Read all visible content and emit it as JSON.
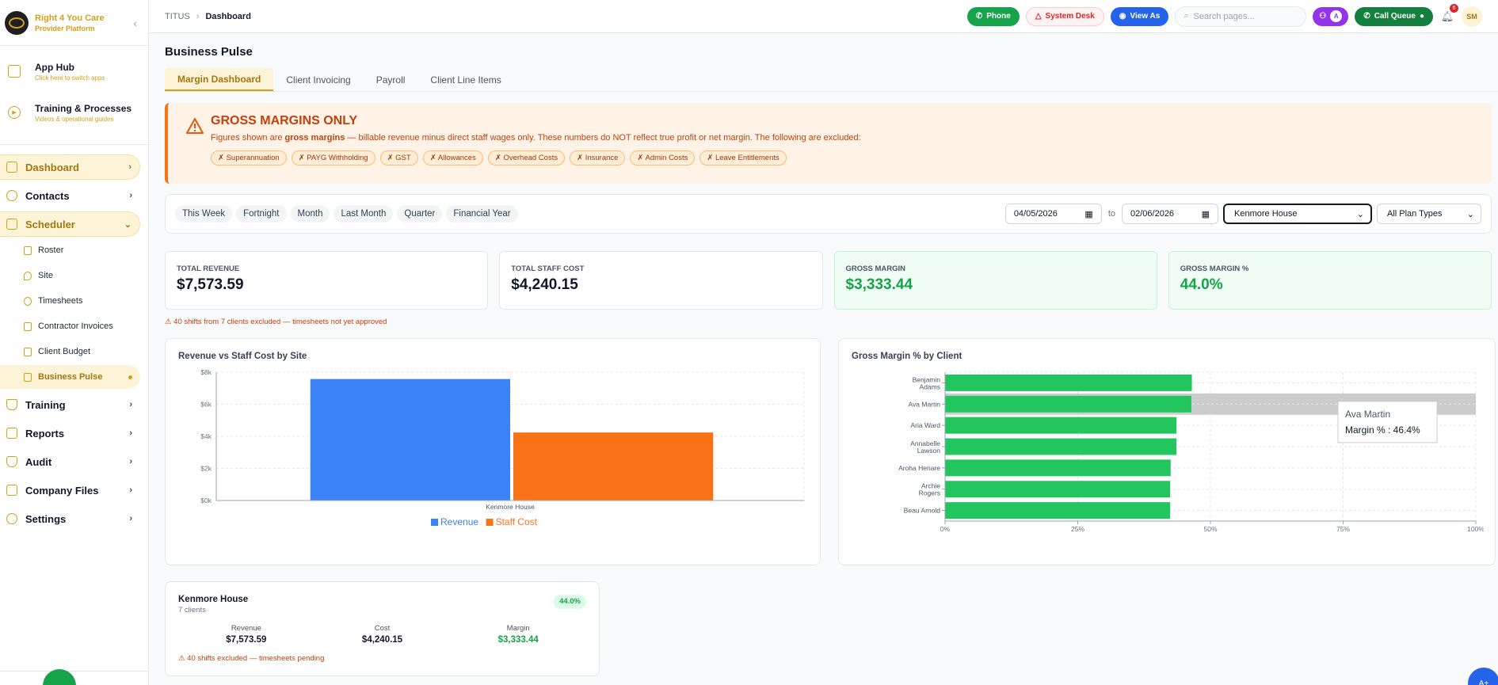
{
  "brand": {
    "name": "Right 4 You Care",
    "subtitle": "Provider Platform"
  },
  "sidebar": {
    "hub_items": [
      {
        "title": "App Hub",
        "subtitle": "Click here to switch apps"
      },
      {
        "title": "Training & Processes",
        "subtitle": "Videos & operational guides"
      }
    ],
    "items": [
      {
        "label": "Dashboard"
      },
      {
        "label": "Contacts"
      },
      {
        "label": "Scheduler"
      },
      {
        "label": "Training"
      },
      {
        "label": "Reports"
      },
      {
        "label": "Audit"
      },
      {
        "label": "Company Files"
      },
      {
        "label": "Settings"
      }
    ],
    "scheduler_sub": [
      {
        "label": "Roster"
      },
      {
        "label": "Site"
      },
      {
        "label": "Timesheets"
      },
      {
        "label": "Contractor Invoices"
      },
      {
        "label": "Client Budget"
      },
      {
        "label": "Business Pulse"
      }
    ]
  },
  "header": {
    "breadcrumb": [
      "TITUS",
      "Dashboard"
    ],
    "phone": "Phone",
    "system_desk": "System Desk",
    "view_as": "View As",
    "search_placeholder": "Search pages...",
    "call_queue": "Call Queue",
    "notif_count": "6",
    "avatar": "SM",
    "purple_avatar": "A"
  },
  "page": {
    "title": "Business Pulse",
    "tabs": [
      "Margin Dashboard",
      "Client Invoicing",
      "Payroll",
      "Client Line Items"
    ]
  },
  "warning": {
    "title": "GROSS MARGINS ONLY",
    "pre": "Figures shown are ",
    "bold": "gross margins",
    "post": " — billable revenue minus direct staff wages only. These numbers do NOT reflect true profit or net margin. The following are excluded:",
    "chips": [
      "✗ Superannuation",
      "✗ PAYG Withholding",
      "✗ GST",
      "✗ Allowances",
      "✗ Overhead Costs",
      "✗ Insurance",
      "✗ Admin Costs",
      "✗ Leave Entitlements"
    ]
  },
  "filters": {
    "periods": [
      "This Week",
      "Fortnight",
      "Month",
      "Last Month",
      "Quarter",
      "Financial Year"
    ],
    "date_from": "04/05/2026",
    "to": "to",
    "date_to": "02/06/2026",
    "site": "Kenmore House",
    "plan": "All Plan Types"
  },
  "kpis": [
    {
      "label": "TOTAL REVENUE",
      "value": "$7,573.59"
    },
    {
      "label": "TOTAL STAFF COST",
      "value": "$4,240.15"
    },
    {
      "label": "GROSS MARGIN",
      "value": "$3,333.44"
    },
    {
      "label": "GROSS MARGIN %",
      "value": "44.0%"
    }
  ],
  "excluded_note": "⚠ 40 shifts from 7 clients excluded — timesheets not yet approved",
  "chart_data": [
    {
      "type": "bar",
      "title": "Revenue vs Staff Cost by Site",
      "categories": [
        "Kenmore House"
      ],
      "series": [
        {
          "name": "Revenue",
          "values": [
            7573.59
          ],
          "color": "#3b82f6"
        },
        {
          "name": "Staff Cost",
          "values": [
            4240.15
          ],
          "color": "#f97316"
        }
      ],
      "yticks": [
        "$0k",
        "$2k",
        "$4k",
        "$6k",
        "$8k"
      ],
      "ylim": [
        0,
        8000
      ],
      "legend": "bottom"
    },
    {
      "type": "bar",
      "orientation": "horizontal",
      "title": "Gross Margin % by Client",
      "categories": [
        "Benjamin Adams",
        "Ava Martin",
        "Aria Ward",
        "Annabelle Lawson",
        "Aroha Henare",
        "Archie Rogers",
        "Beau Arnold"
      ],
      "values": [
        46.5,
        46.4,
        43.6,
        43.6,
        42.5,
        42.4,
        42.4
      ],
      "xticks": [
        "0%",
        "25%",
        "50%",
        "75%",
        "100%"
      ],
      "xlim": [
        0,
        100
      ],
      "color": "#22c55e",
      "tooltip": {
        "name": "Ava Martin",
        "label": "Margin % : 46.4%"
      }
    }
  ],
  "site_card": {
    "name": "Kenmore House",
    "clients": "7 clients",
    "badge": "44.0%",
    "stats": [
      {
        "label": "Revenue",
        "value": "$7,573.59"
      },
      {
        "label": "Cost",
        "value": "$4,240.15"
      },
      {
        "label": "Margin",
        "value": "$3,333.44"
      }
    ],
    "warning": "⚠ 40 shifts excluded — timesheets pending"
  },
  "fab": "A+"
}
